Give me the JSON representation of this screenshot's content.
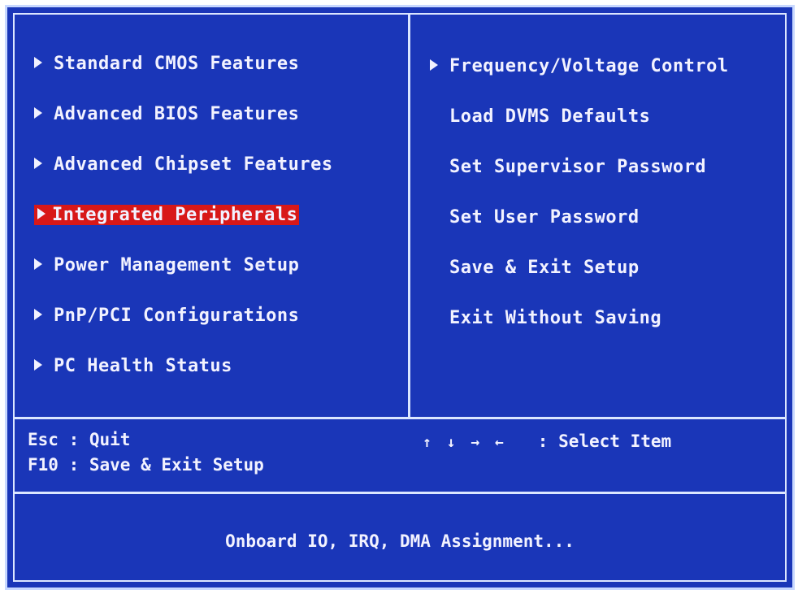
{
  "colors": {
    "background": "#1a36b8",
    "text": "#f2f2ff",
    "highlight": "#d81818",
    "frame": "#dbe6ff"
  },
  "left_menu": {
    "items": [
      {
        "label": "Standard CMOS Features",
        "has_arrow": true,
        "selected": false
      },
      {
        "label": "Advanced BIOS Features",
        "has_arrow": true,
        "selected": false
      },
      {
        "label": "Advanced Chipset Features",
        "has_arrow": true,
        "selected": false
      },
      {
        "label": "Integrated Peripherals",
        "has_arrow": true,
        "selected": true
      },
      {
        "label": "Power Management Setup",
        "has_arrow": true,
        "selected": false
      },
      {
        "label": "PnP/PCI Configurations",
        "has_arrow": true,
        "selected": false
      },
      {
        "label": "PC Health Status",
        "has_arrow": true,
        "selected": false
      }
    ]
  },
  "right_menu": {
    "items": [
      {
        "label": "Frequency/Voltage Control",
        "has_arrow": true
      },
      {
        "label": "Load DVMS Defaults",
        "has_arrow": false
      },
      {
        "label": "Set Supervisor Password",
        "has_arrow": false
      },
      {
        "label": "Set User Password",
        "has_arrow": false
      },
      {
        "label": "Save & Exit Setup",
        "has_arrow": false
      },
      {
        "label": "Exit Without Saving",
        "has_arrow": false
      }
    ]
  },
  "help_bar": {
    "esc": "Esc : Quit",
    "f10": "F10 : Save & Exit Setup",
    "arrows": "↑ ↓ → ←",
    "select": ": Select Item"
  },
  "status": {
    "description": "Onboard IO, IRQ, DMA Assignment..."
  }
}
